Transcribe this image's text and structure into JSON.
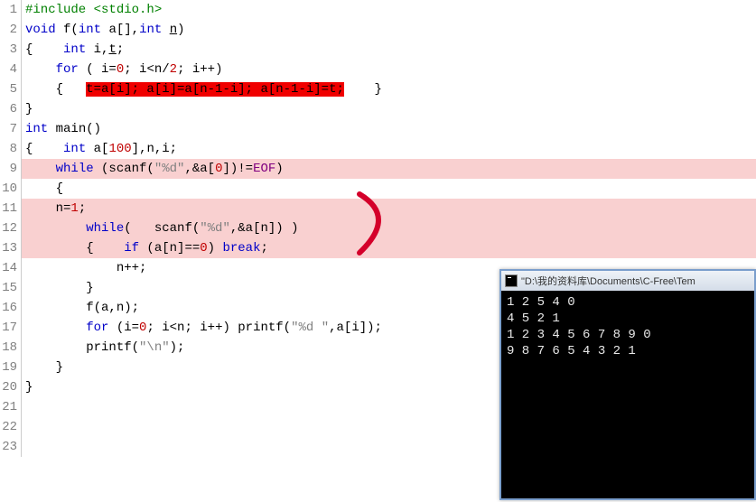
{
  "code": {
    "lines": [
      [
        {
          "t": "#include",
          "c": "tok-pp"
        },
        {
          "t": " ",
          "c": ""
        },
        {
          "t": "<stdio.h>",
          "c": "tok-pp"
        }
      ],
      [
        {
          "t": "void",
          "c": "tok-ty"
        },
        {
          "t": " f(",
          "c": "tok-punc"
        },
        {
          "t": "int",
          "c": "tok-ty"
        },
        {
          "t": " a[],",
          "c": "tok-punc"
        },
        {
          "t": "int",
          "c": "tok-ty"
        },
        {
          "t": " ",
          "c": ""
        },
        {
          "t": "n",
          "c": "underline"
        },
        {
          "t": ")",
          "c": "tok-punc"
        }
      ],
      [
        {
          "t": "{    ",
          "c": "tok-punc"
        },
        {
          "t": "int",
          "c": "tok-ty"
        },
        {
          "t": " i,",
          "c": "tok-punc"
        },
        {
          "t": "t",
          "c": "underline"
        },
        {
          "t": ";",
          "c": "tok-punc"
        }
      ],
      [
        {
          "t": "    ",
          "c": ""
        },
        {
          "t": "for",
          "c": "tok-kw"
        },
        {
          "t": " ( i=",
          "c": "tok-punc"
        },
        {
          "t": "0",
          "c": "tok-num"
        },
        {
          "t": "; i<n/",
          "c": "tok-punc"
        },
        {
          "t": "2",
          "c": "tok-num"
        },
        {
          "t": "; i++)",
          "c": "tok-punc"
        }
      ],
      [
        {
          "t": "    {   ",
          "c": "tok-punc"
        },
        {
          "t": "t=a[i]; a[i]=a[n-1-i]; a[n-1-i]=t;",
          "c": "hl-red"
        },
        {
          "t": "    }",
          "c": "tok-punc"
        }
      ],
      [
        {
          "t": "}",
          "c": "tok-punc"
        }
      ],
      [
        {
          "t": "int",
          "c": "tok-ty"
        },
        {
          "t": " main()",
          "c": "tok-punc"
        }
      ],
      [
        {
          "t": "{    ",
          "c": "tok-punc"
        },
        {
          "t": "int",
          "c": "tok-ty"
        },
        {
          "t": " a[",
          "c": "tok-punc"
        },
        {
          "t": "100",
          "c": "tok-num"
        },
        {
          "t": "],n,i;",
          "c": "tok-punc"
        }
      ],
      [
        {
          "t": "    ",
          "c": ""
        },
        {
          "t": "while",
          "c": "tok-kw"
        },
        {
          "t": " (scanf(",
          "c": "tok-punc"
        },
        {
          "t": "\"%d\"",
          "c": "tok-str"
        },
        {
          "t": ",&a[",
          "c": "tok-punc"
        },
        {
          "t": "0",
          "c": "tok-num"
        },
        {
          "t": "])!=",
          "c": "tok-punc"
        },
        {
          "t": "EOF",
          "c": "tok-const"
        },
        {
          "t": ")",
          "c": "tok-punc"
        }
      ],
      [
        {
          "t": "    {",
          "c": "tok-punc"
        }
      ],
      [
        {
          "t": "    n=",
          "c": "tok-punc"
        },
        {
          "t": "1",
          "c": "tok-num"
        },
        {
          "t": ";",
          "c": "tok-punc"
        }
      ],
      [
        {
          "t": "        ",
          "c": ""
        },
        {
          "t": "while",
          "c": "tok-kw"
        },
        {
          "t": "(   scanf(",
          "c": "tok-punc"
        },
        {
          "t": "\"%d\"",
          "c": "tok-str"
        },
        {
          "t": ",&a[n]) )",
          "c": "tok-punc"
        }
      ],
      [
        {
          "t": "        {    ",
          "c": "tok-punc"
        },
        {
          "t": "if",
          "c": "tok-kw"
        },
        {
          "t": " (a[n]==",
          "c": "tok-punc"
        },
        {
          "t": "0",
          "c": "tok-num"
        },
        {
          "t": ") ",
          "c": "tok-punc"
        },
        {
          "t": "break",
          "c": "tok-kw"
        },
        {
          "t": ";",
          "c": "tok-punc"
        }
      ],
      [
        {
          "t": "            n++;",
          "c": "tok-punc"
        }
      ],
      [
        {
          "t": "        }",
          "c": "tok-punc"
        }
      ],
      [
        {
          "t": "        f(a,n);",
          "c": "tok-punc"
        }
      ],
      [
        {
          "t": "        ",
          "c": ""
        },
        {
          "t": "for",
          "c": "tok-kw"
        },
        {
          "t": " (i=",
          "c": "tok-punc"
        },
        {
          "t": "0",
          "c": "tok-num"
        },
        {
          "t": "; i<n; i++) printf(",
          "c": "tok-punc"
        },
        {
          "t": "\"%d \"",
          "c": "tok-str"
        },
        {
          "t": ",a[i]);",
          "c": "tok-punc"
        }
      ],
      [
        {
          "t": "        printf(",
          "c": "tok-punc"
        },
        {
          "t": "\"\\n\"",
          "c": "tok-str"
        },
        {
          "t": ");",
          "c": "tok-punc"
        }
      ],
      [
        {
          "t": "    }",
          "c": "tok-punc"
        }
      ],
      [
        {
          "t": "}",
          "c": "tok-punc"
        }
      ],
      [],
      [],
      []
    ],
    "pinkLines": [
      9,
      11,
      12,
      13
    ],
    "redSpanLine": 5
  },
  "console": {
    "title": "\"D:\\我的资料库\\Documents\\C-Free\\Tem",
    "output": "1 2 5 4 0\n4 5 2 1\n1 2 3 4 5 6 7 8 9 0\n9 8 7 6 5 4 3 2 1"
  }
}
